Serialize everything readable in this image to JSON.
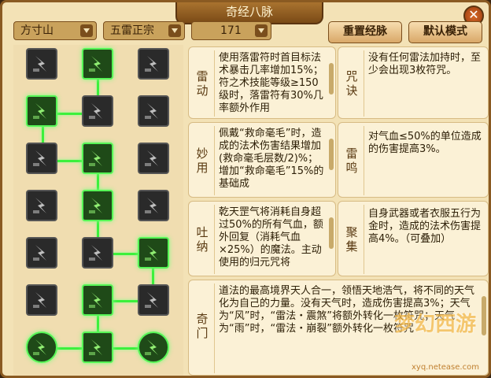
{
  "window": {
    "title": "奇经八脉",
    "close_icon": "close-icon"
  },
  "toolbar": {
    "school": "方寸山",
    "branch": "五雷正宗",
    "level": "171",
    "reset_label": "重置经脉",
    "default_label": "默认模式"
  },
  "colors": {
    "active": "#56f556",
    "inactive": "#555555",
    "panel": "#fbf1d6"
  },
  "meridian_nodes": [
    {
      "name": "node-r1-c1",
      "active": false,
      "icon": "lightning-figure-icon"
    },
    {
      "name": "node-r1-c2",
      "active": true,
      "icon": "talisman-strike-icon"
    },
    {
      "name": "node-r1-c3",
      "active": false,
      "icon": "zigzag-talisman-icon"
    },
    {
      "name": "node-r2-c1",
      "active": true,
      "icon": "green-talisman-icon"
    },
    {
      "name": "node-r2-c2",
      "active": false,
      "icon": "shattered-block-icon"
    },
    {
      "name": "node-r2-c3",
      "active": false,
      "icon": "chain-lock-icon"
    },
    {
      "name": "node-r3-c1",
      "active": false,
      "icon": "thunder-cloud-icon"
    },
    {
      "name": "node-r3-c2",
      "active": true,
      "icon": "swirl-flame-icon"
    },
    {
      "name": "node-r3-c3",
      "active": false,
      "icon": "feather-icon"
    },
    {
      "name": "node-r4-c1",
      "active": false,
      "icon": "thunder-man-icon"
    },
    {
      "name": "node-r4-c2",
      "active": true,
      "icon": "down-arrow-burst-icon"
    },
    {
      "name": "node-r4-c3",
      "active": false,
      "icon": "taiji-scroll-icon"
    },
    {
      "name": "node-r5-c1",
      "active": false,
      "icon": "triple-arrow-icon"
    },
    {
      "name": "node-r5-c2",
      "active": false,
      "icon": "river-flow-icon"
    },
    {
      "name": "node-r5-c3",
      "active": true,
      "icon": "spiral-ring-icon"
    },
    {
      "name": "node-r6-c1",
      "active": false,
      "icon": "fanned-cards-icon"
    },
    {
      "name": "node-r6-c2",
      "active": true,
      "icon": "green-cards-icon"
    },
    {
      "name": "node-r6-c3",
      "active": false,
      "icon": "dark-swirl-icon"
    },
    {
      "name": "node-r7-c1",
      "active": true,
      "icon": "dragon-orb-icon"
    },
    {
      "name": "node-r7-c2",
      "active": true,
      "icon": "hooded-figure-icon"
    },
    {
      "name": "node-r7-c3",
      "active": true,
      "icon": "dragon-orb-icon"
    }
  ],
  "skills": [
    {
      "label": "雷动",
      "text": "使用落雷符时首目标法术暴击几率增加15%；符之术技能等级≥150级时，落雷符有30%几率额外作用"
    },
    {
      "label": "咒诀",
      "text": "没有任何雷法加持时，至少会出现3枚符咒。"
    },
    {
      "label": "妙用",
      "text": "佩戴“救命毫毛”时，造成的法术伤害结果增加(救命毫毛层数/2)%；增加“救命毫毛”15%的基础成"
    },
    {
      "label": "雷鸣",
      "text": "对气血≤50%的单位造成的伤害提高3%。"
    },
    {
      "label": "吐纳",
      "text": "乾天罡气将消耗自身超过50%的所有气血，额外回复（消耗气血×25%）的魔法。主动使用的归元咒将"
    },
    {
      "label": "聚集",
      "text": "自身武器或者衣服五行为金时，造成的法术伤害提高4%。（可叠加）"
    },
    {
      "label": "奇门",
      "text": "道法的最高境界天人合一，领悟天地浩气，将不同的天气化为自己的力量。没有天气时，造成伤害提高3%；天气为“风”时，“雷法・震煞”将额外转化一枚符咒；天气为“雨”时，“雷法・崩裂”额外转化一枚符咒"
    }
  ],
  "watermark": {
    "url": "xyq.netease.com"
  }
}
